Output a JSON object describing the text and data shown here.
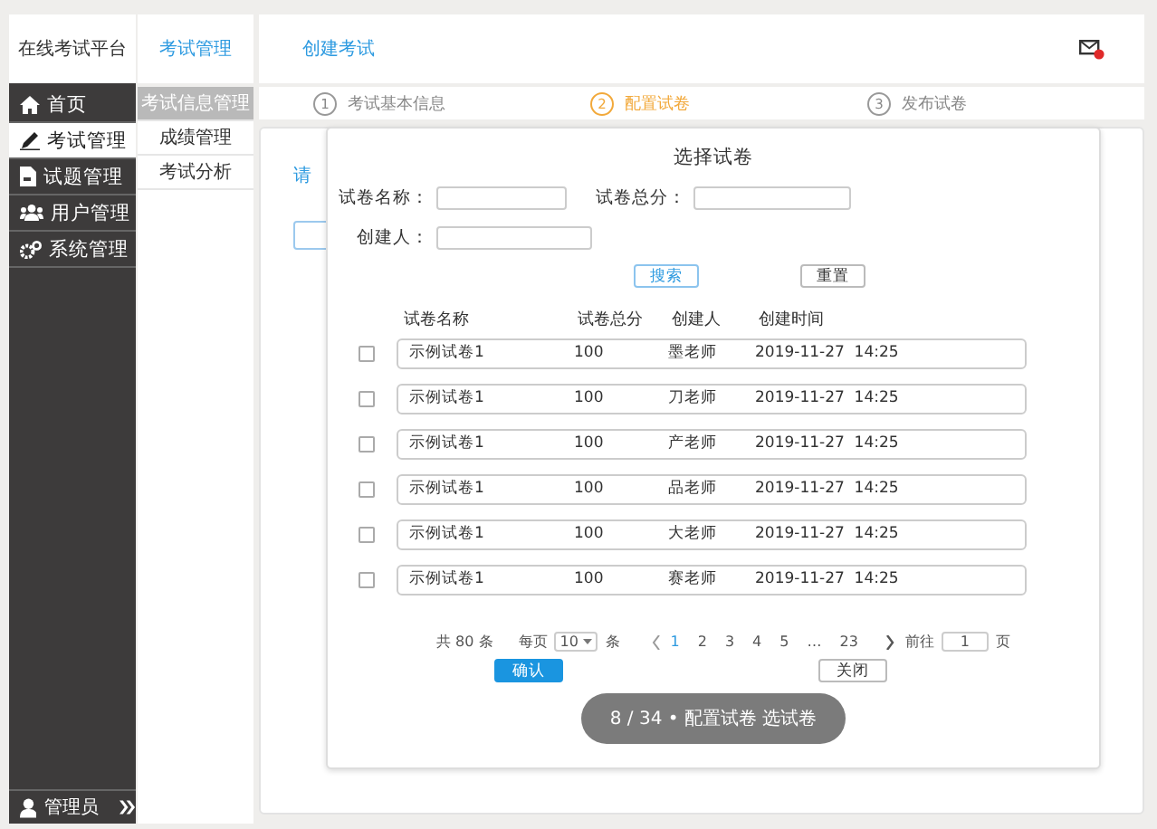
{
  "sidebar": {
    "brand": "在线考试平台",
    "items": [
      {
        "label": "首页",
        "selected": false
      },
      {
        "label": "考试管理",
        "selected": true
      },
      {
        "label": "试题管理",
        "selected": false
      },
      {
        "label": "用户管理",
        "selected": false
      },
      {
        "label": "系统管理",
        "selected": false
      }
    ],
    "user": "管理员"
  },
  "submenu": {
    "title": "考试管理",
    "items": [
      {
        "label": "考试信息管理",
        "selected": true
      },
      {
        "label": "成绩管理",
        "selected": false
      },
      {
        "label": "考试分析",
        "selected": false
      }
    ]
  },
  "header": {
    "title": "创建考试"
  },
  "steps": [
    {
      "number": "1",
      "label": "考试基本信息",
      "selected": false
    },
    {
      "number": "2",
      "label": "配置试卷",
      "selected": true
    },
    {
      "number": "3",
      "label": "发布试卷",
      "selected": false
    }
  ],
  "card": {
    "prompt": "请"
  },
  "modal": {
    "title": "选择试卷",
    "filters": [
      {
        "label": "试卷名称："
      },
      {
        "label": "试卷总分："
      },
      {
        "label": "创建人："
      }
    ],
    "buttons": [
      {
        "label": "搜索",
        "kind": "primary"
      },
      {
        "label": "重置",
        "kind": "default"
      }
    ],
    "table": {
      "columns": [
        "试卷名称",
        "试卷总分",
        "创建人",
        "创建时间"
      ],
      "rows": [
        {
          "checked": false,
          "cells": [
            "示例试卷1",
            "100",
            "墨老师",
            "2019-11-27  14:25"
          ]
        },
        {
          "checked": false,
          "cells": [
            "示例试卷1",
            "100",
            "刀老师",
            "2019-11-27  14:25"
          ]
        },
        {
          "checked": false,
          "cells": [
            "示例试卷1",
            "100",
            "产老师",
            "2019-11-27  14:25"
          ]
        },
        {
          "checked": false,
          "cells": [
            "示例试卷1",
            "100",
            "品老师",
            "2019-11-27  14:25"
          ]
        },
        {
          "checked": false,
          "cells": [
            "示例试卷1",
            "100",
            "大老师",
            "2019-11-27  14:25"
          ]
        },
        {
          "checked": false,
          "cells": [
            "示例试卷1",
            "100",
            "赛老师",
            "2019-11-27  14:25"
          ]
        }
      ]
    },
    "pagination": {
      "total": "共 80 条",
      "per_page_label": "每页",
      "per_page": "10",
      "per_page_unit": "条",
      "pages": [
        {
          "label": "1",
          "selected": true
        },
        {
          "label": "2",
          "selected": false
        },
        {
          "label": "3",
          "selected": false
        },
        {
          "label": "4",
          "selected": false
        },
        {
          "label": "5",
          "selected": false
        },
        {
          "label": "…",
          "selected": false
        },
        {
          "label": "23",
          "selected": false
        }
      ],
      "goto_label": "前往",
      "goto_value": "1",
      "goto_unit": "页"
    },
    "actions": [
      {
        "label": "确认",
        "kind": "primary"
      },
      {
        "label": "关闭",
        "kind": "default"
      }
    ]
  },
  "slide_caption": "8 / 34 • 配置试卷 选试卷"
}
